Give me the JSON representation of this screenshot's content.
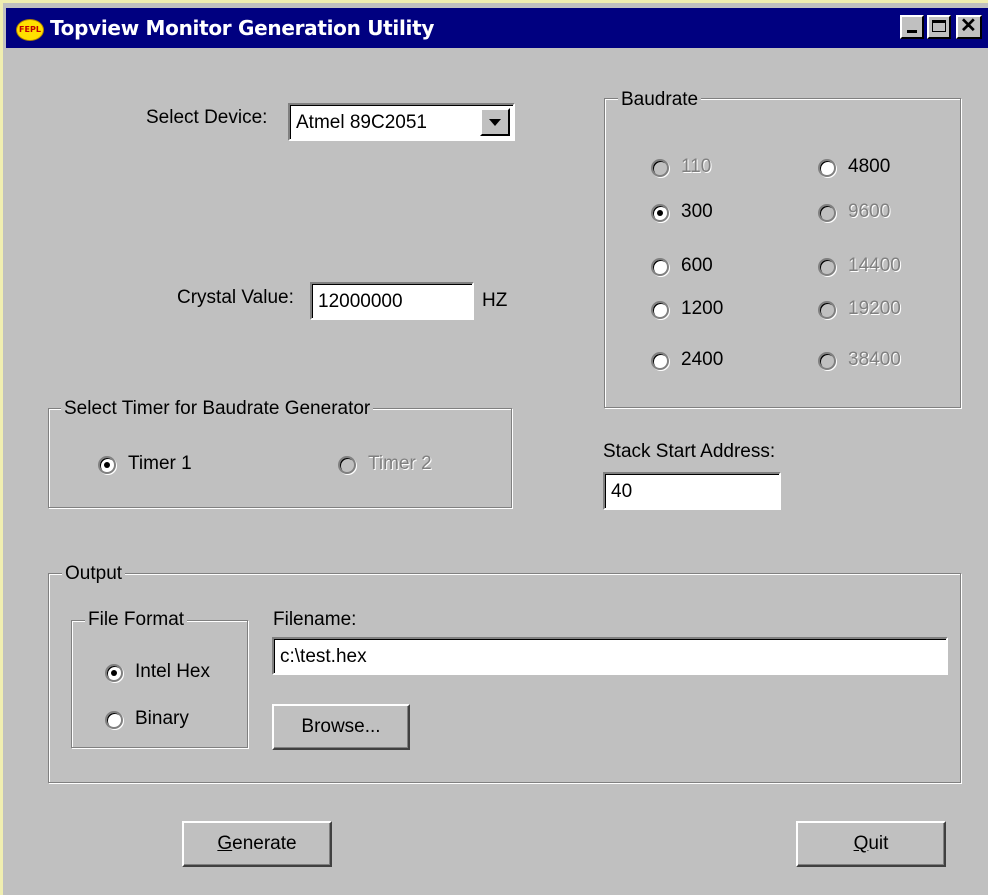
{
  "window": {
    "title": "Topview Monitor Generation Utility",
    "logo_text": "FEPL"
  },
  "device": {
    "label": "Select Device:",
    "value": "Atmel 89C2051"
  },
  "crystal": {
    "label": "Crystal Value:",
    "value": "12000000",
    "unit": "HZ"
  },
  "timer_group": {
    "legend": "Select Timer for Baudrate Generator",
    "options": [
      {
        "label": "Timer 1",
        "selected": true,
        "enabled": true
      },
      {
        "label": "Timer 2",
        "selected": false,
        "enabled": false
      }
    ]
  },
  "baudrate_group": {
    "legend": "Baudrate",
    "options": [
      {
        "label": "110",
        "selected": false,
        "enabled": false
      },
      {
        "label": "300",
        "selected": true,
        "enabled": true
      },
      {
        "label": "600",
        "selected": false,
        "enabled": true
      },
      {
        "label": "1200",
        "selected": false,
        "enabled": true
      },
      {
        "label": "2400",
        "selected": false,
        "enabled": true
      },
      {
        "label": "4800",
        "selected": false,
        "enabled": true
      },
      {
        "label": "9600",
        "selected": false,
        "enabled": false
      },
      {
        "label": "14400",
        "selected": false,
        "enabled": false
      },
      {
        "label": "19200",
        "selected": false,
        "enabled": false
      },
      {
        "label": "38400",
        "selected": false,
        "enabled": false
      }
    ]
  },
  "stack": {
    "label": "Stack Start Address:",
    "value": "40"
  },
  "output_group": {
    "legend": "Output",
    "file_format": {
      "legend": "File Format",
      "options": [
        {
          "label": "Intel Hex",
          "selected": true,
          "enabled": true
        },
        {
          "label": "Binary",
          "selected": false,
          "enabled": true
        }
      ]
    },
    "filename_label": "Filename:",
    "filename_value": "c:\\test.hex",
    "browse_label": "Browse..."
  },
  "buttons": {
    "generate_mnemonic": "G",
    "generate_rest": "enerate",
    "quit_mnemonic": "Q",
    "quit_rest": "uit"
  }
}
